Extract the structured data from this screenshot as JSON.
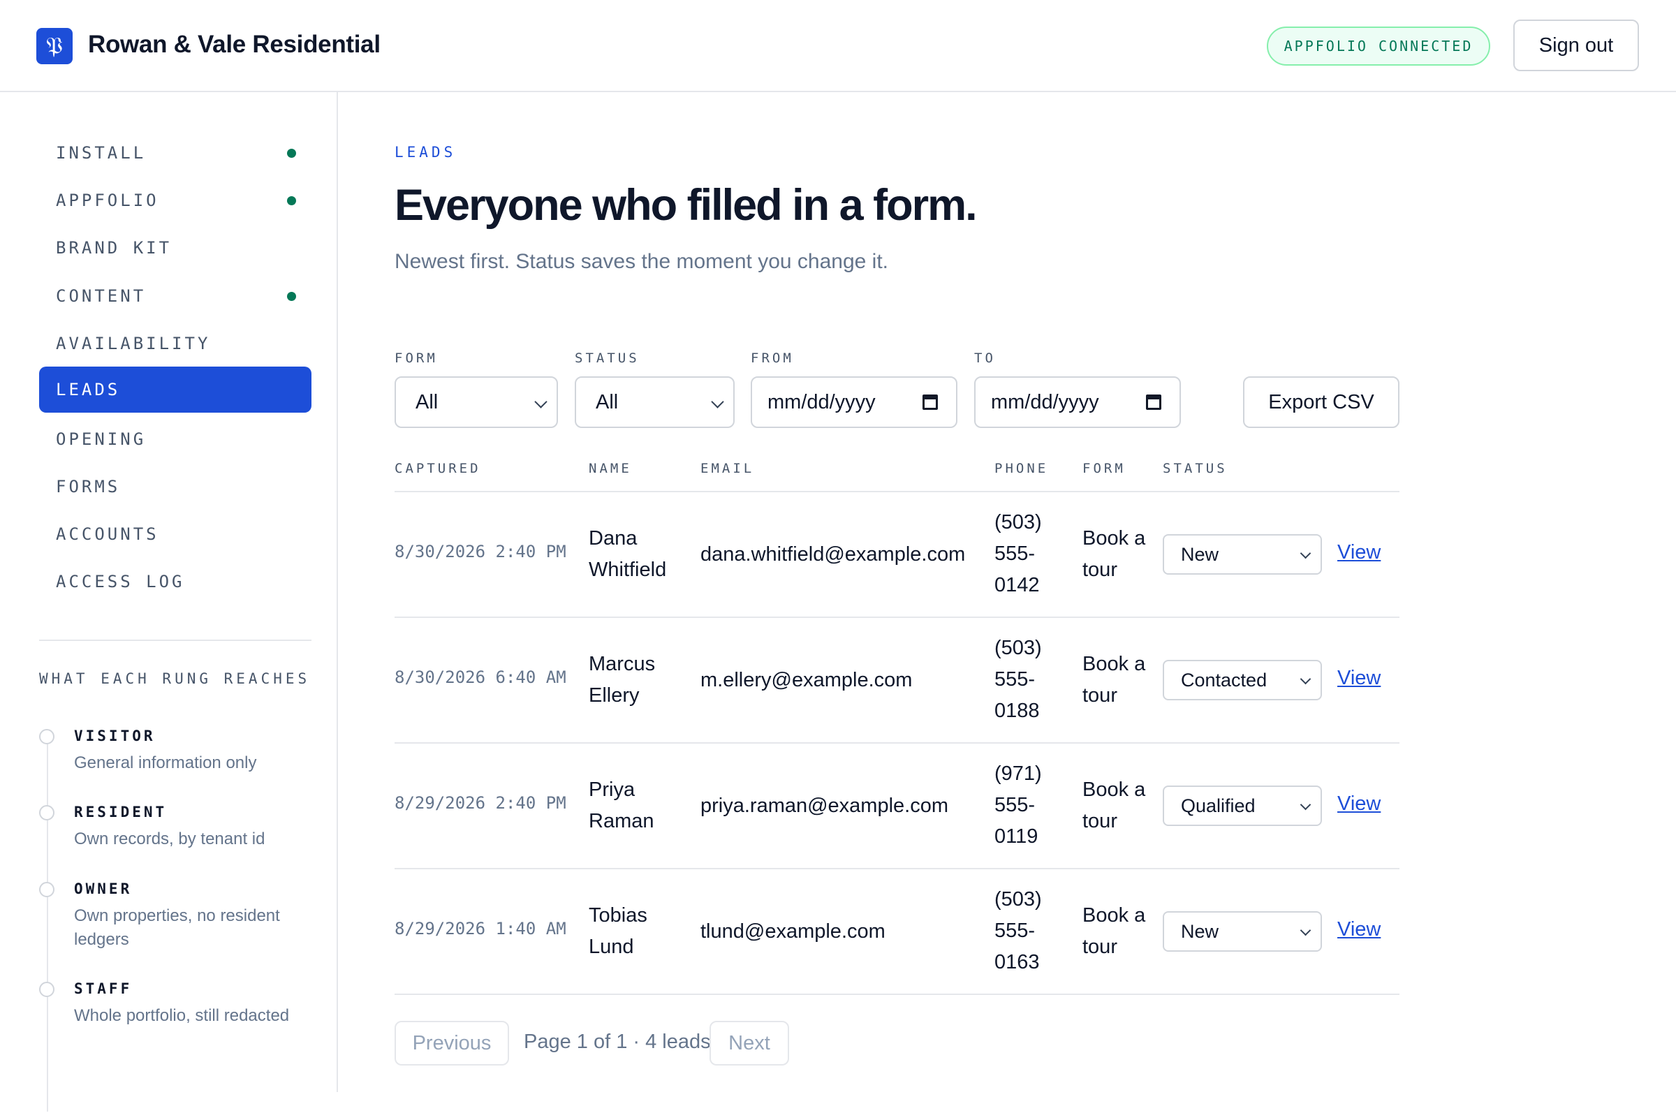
{
  "app": {
    "logo_glyph": "𝔓",
    "brand_name": "Rowan & Vale Residential",
    "connection_badge": "APPFOLIO CONNECTED",
    "sign_out_label": "Sign out",
    "accent_color": "#1d4ed8",
    "success_color": "#047857"
  },
  "sidebar": {
    "items": [
      {
        "label": "INSTALL",
        "done": true
      },
      {
        "label": "APPFOLIO",
        "done": true
      },
      {
        "label": "BRAND KIT",
        "done": false
      },
      {
        "label": "CONTENT",
        "done": true
      },
      {
        "label": "AVAILABILITY",
        "done": false
      },
      {
        "label": "LEADS",
        "done": false,
        "active": true
      },
      {
        "label": "OPENING",
        "done": false
      },
      {
        "label": "FORMS",
        "done": false
      },
      {
        "label": "ACCOUNTS",
        "done": false
      },
      {
        "label": "ACCESS LOG",
        "done": false
      }
    ],
    "rungs_heading": "WHAT EACH RUNG REACHES",
    "rungs": [
      {
        "title": "VISITOR",
        "desc": "General information only"
      },
      {
        "title": "RESIDENT",
        "desc": "Own records, by tenant id"
      },
      {
        "title": "OWNER",
        "desc": "Own properties, no resident ledgers"
      },
      {
        "title": "STAFF",
        "desc": "Whole portfolio, still redacted"
      }
    ]
  },
  "main": {
    "eyebrow": "LEADS",
    "title": "Everyone who filled in a form.",
    "subtitle": "Newest first. Status saves the moment you change it.",
    "filters": {
      "form": {
        "label": "FORM",
        "value": "All"
      },
      "status": {
        "label": "STATUS",
        "value": "All"
      },
      "from": {
        "label": "FROM",
        "placeholder": "mm/dd/yyyy"
      },
      "to": {
        "label": "TO",
        "placeholder": "mm/dd/yyyy"
      },
      "export_label": "Export CSV"
    },
    "table": {
      "headers": [
        "CAPTURED",
        "NAME",
        "EMAIL",
        "PHONE",
        "FORM",
        "STATUS"
      ],
      "rows": [
        {
          "captured": "8/30/2026 2:40 PM",
          "name": "Dana Whitfield",
          "email": "dana.whitfield@example.com",
          "phone": "(503) 555-0142",
          "form": "Book a tour",
          "status": "New",
          "action": "View"
        },
        {
          "captured": "8/30/2026 6:40 AM",
          "name": "Marcus Ellery",
          "email": "m.ellery@example.com",
          "phone": "(503) 555-0188",
          "form": "Book a tour",
          "status": "Contacted",
          "action": "View"
        },
        {
          "captured": "8/29/2026 2:40 PM",
          "name": "Priya Raman",
          "email": "priya.raman@example.com",
          "phone": "(971) 555-0119",
          "form": "Book a tour",
          "status": "Qualified",
          "action": "View"
        },
        {
          "captured": "8/29/2026 1:40 AM",
          "name": "Tobias Lund",
          "email": "tlund@example.com",
          "phone": "(503) 555-0163",
          "form": "Book a tour",
          "status": "New",
          "action": "View"
        }
      ]
    },
    "pagination": {
      "previous_label": "Previous",
      "info": "Page 1 of 1 · 4 leads",
      "next_label": "Next"
    }
  }
}
